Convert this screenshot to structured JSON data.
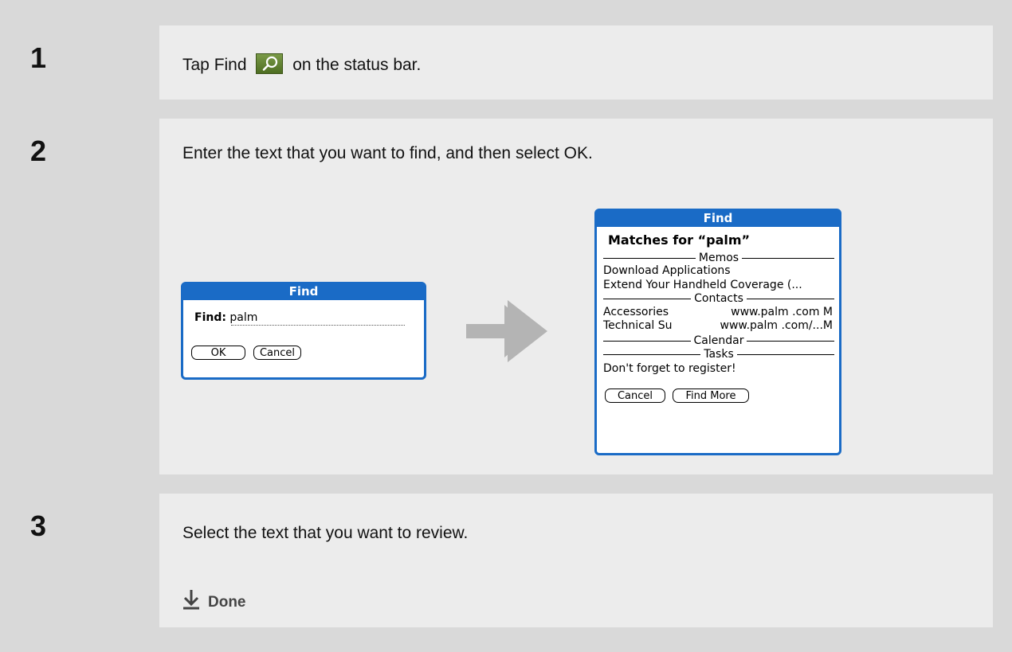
{
  "steps": [
    {
      "number": "1",
      "text_before": "Tap Find",
      "text_after": "on the status bar."
    },
    {
      "number": "2",
      "text": "Enter the text that you want to find, and then select OK."
    },
    {
      "number": "3",
      "text": "Select the text that you want to review."
    }
  ],
  "icon_names": {
    "find": "find-magnifier-icon",
    "arrow": "right-arrow-icon",
    "done": "done-down-arrow-icon"
  },
  "find_dialog": {
    "title": "Find",
    "field_label": "Find:",
    "field_value": "palm",
    "ok_button": "OK",
    "cancel_button": "Cancel"
  },
  "results_dialog": {
    "title": "Find",
    "heading": "Matches for “palm”",
    "sections": {
      "memos": "Memos",
      "contacts": "Contacts",
      "calendar": "Calendar",
      "tasks": "Tasks"
    },
    "memo_items": [
      "Download Applications",
      "Extend Your Handheld Coverage (..."
    ],
    "contact_items": [
      {
        "name": "Accessories",
        "value": "www.palm .com M"
      },
      {
        "name": "Technical Su",
        "value": "www.palm .com/...M"
      }
    ],
    "task_items": [
      "Don't forget to register!"
    ],
    "cancel_button": "Cancel",
    "find_more_button": "Find More"
  },
  "done_label": "Done",
  "colors": {
    "palm_blue": "#1a6bc6",
    "arrow_gray": "#b4b4b4"
  }
}
